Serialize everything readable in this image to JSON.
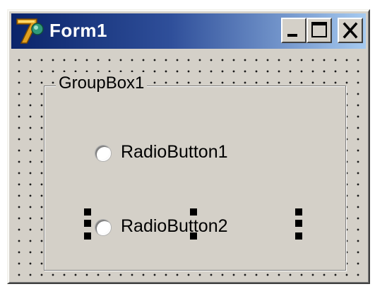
{
  "window": {
    "title": "Form1",
    "icon": "delphi-app-icon",
    "caption_buttons": [
      "minimize-icon",
      "maximize-icon",
      "close-icon"
    ]
  },
  "groupbox": {
    "caption": "GroupBox1",
    "radios": [
      {
        "label": "RadioButton1",
        "checked": false
      },
      {
        "label": "RadioButton2",
        "checked": false,
        "selected_in_designer": true
      }
    ]
  },
  "colors": {
    "titlebar_start": "#0a246a",
    "titlebar_end": "#a6caf0",
    "face": "#d4d0c8",
    "selection_handles": "#000000"
  }
}
